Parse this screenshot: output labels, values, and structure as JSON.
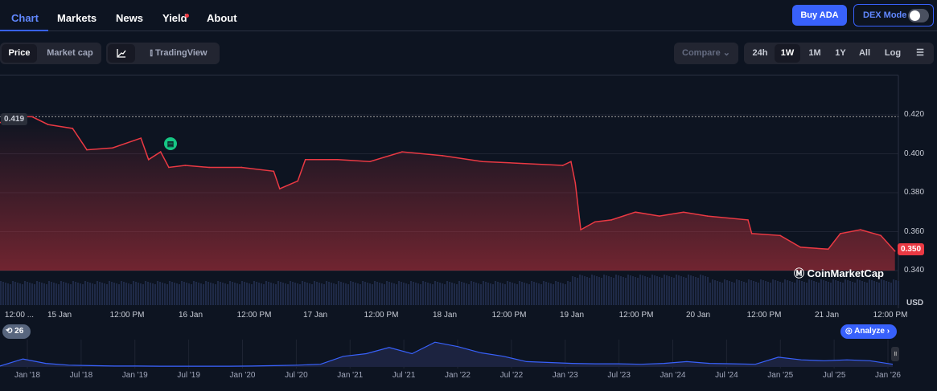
{
  "nav": {
    "tabs": [
      "Chart",
      "Markets",
      "News",
      "Yield",
      "About"
    ],
    "active": "Chart",
    "buy_label": "Buy ADA",
    "dex_label": "DEX Mode",
    "dex_on": false
  },
  "toolbar": {
    "price": "Price",
    "market_cap": "Market cap",
    "tradingview": "TradingView",
    "compare": "Compare",
    "ranges": [
      "24h",
      "1W",
      "1M",
      "1Y",
      "All"
    ],
    "active_range": "1W",
    "log": "Log"
  },
  "colors": {
    "line": "#ea3943",
    "accent": "#3861fb",
    "bg": "#0d1421"
  },
  "labels": {
    "high": "0.419",
    "current": "0.350",
    "currency": "USD",
    "watermark": "CoinMarketCap",
    "history_count": "26",
    "analyze": "Analyze"
  },
  "chart_data": {
    "type": "line",
    "ylabel": "USD",
    "ylim": [
      0.333,
      0.43
    ],
    "yticks": [
      "0.420",
      "0.400",
      "0.380",
      "0.360",
      "0.340"
    ],
    "xticks": [
      "12:00 ...",
      "15 Jan",
      "12:00 PM",
      "16 Jan",
      "12:00 PM",
      "17 Jan",
      "12:00 PM",
      "18 Jan",
      "12:00 PM",
      "19 Jan",
      "12:00 PM",
      "20 Jan",
      "12:00 PM",
      "21 Jan",
      "12:00 PM"
    ],
    "x_hours_since_15jan": [
      -10.9,
      -6.5,
      -5,
      -2.1,
      2.4,
      5,
      9.7,
      14.9,
      16.3,
      18.5,
      20,
      23,
      27.4,
      33.3,
      39.2,
      40.3,
      43.6,
      45,
      50.9,
      56.8,
      62.7,
      70.1,
      77.4,
      84.8,
      92.1,
      93.6,
      94.4,
      95.4,
      98,
      101,
      105.4,
      109.8,
      114.2,
      118.6,
      126,
      126.7,
      131.9,
      135.6,
      140.7,
      142.9,
      146.6,
      150.3,
      152.9
    ],
    "price": [
      0.416,
      0.419,
      0.419,
      0.415,
      0.413,
      0.402,
      0.403,
      0.408,
      0.397,
      0.401,
      0.393,
      0.394,
      0.393,
      0.393,
      0.391,
      0.382,
      0.386,
      0.397,
      0.397,
      0.396,
      0.401,
      0.399,
      0.396,
      0.395,
      0.394,
      0.396,
      0.385,
      0.361,
      0.365,
      0.366,
      0.37,
      0.368,
      0.37,
      0.368,
      0.366,
      0.359,
      0.358,
      0.352,
      0.351,
      0.359,
      0.361,
      0.358,
      0.35
    ],
    "navigator": {
      "xticks": [
        "Jan '18",
        "Jul '18",
        "Jan '19",
        "Jul '19",
        "Jan '20",
        "Jul '20",
        "Jan '21",
        "Jul '21",
        "Jan '22",
        "Jul '22",
        "Jan '23",
        "Jul '23",
        "Jan '24",
        "Jul '24",
        "Jan '25",
        "Jul '25",
        "Jan '26"
      ],
      "values": [
        0.1,
        0.9,
        0.4,
        0.2,
        0.15,
        0.1,
        0.1,
        0.08,
        0.08,
        0.08,
        0.08,
        0.1,
        0.15,
        0.2,
        0.3,
        1.2,
        1.5,
        2.2,
        1.5,
        2.8,
        2.3,
        1.6,
        1.2,
        0.6,
        0.5,
        0.4,
        0.35,
        0.35,
        0.3,
        0.4,
        0.6,
        0.4,
        0.35,
        0.3,
        1.1,
        0.8,
        0.7,
        0.8,
        0.7,
        0.3
      ]
    }
  }
}
